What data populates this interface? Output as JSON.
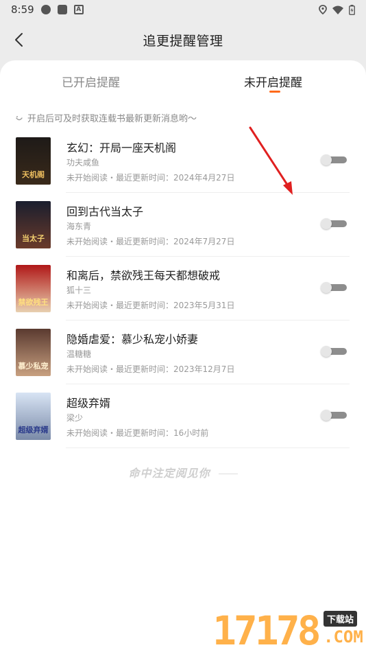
{
  "status_bar": {
    "time": "8:59",
    "icons": [
      "settings-icon",
      "square-app-icon",
      "a-app-icon",
      "location-icon",
      "wifi-icon",
      "battery-icon"
    ]
  },
  "header": {
    "title": "追更提醒管理",
    "back_icon": "chevron-left-icon"
  },
  "tabs": [
    {
      "label": "已开启提醒",
      "active": false
    },
    {
      "label": "未开启提醒",
      "active": true
    }
  ],
  "tip": "开启后可及时获取连载书最新更新消息哟～",
  "books": [
    {
      "title": "玄幻：开局一座天机阁",
      "author": "功夫咸鱼",
      "meta": "未开始阅读・最近更新时间：2024年4月27日",
      "cover_text": "天机阁",
      "cover_colors": [
        "#1e1a18",
        "#3a2a1a"
      ],
      "cover_text_color": "#f0c060",
      "toggle_on": false
    },
    {
      "title": "回到古代当太子",
      "author": "海东青",
      "meta": "未开始阅读・最近更新时间：2024年7月27日",
      "cover_text": "当太子",
      "cover_colors": [
        "#1a1e2e",
        "#6a3a2a"
      ],
      "cover_text_color": "#f2d070",
      "toggle_on": false
    },
    {
      "title": "和离后，禁欲残王每天都想破戒",
      "author": "狐十三",
      "meta": "未开始阅读・最近更新时间：2023年5月31日",
      "cover_text": "禁欲残王",
      "cover_colors": [
        "#b01818",
        "#e8d0b0"
      ],
      "cover_text_color": "#ffe080",
      "toggle_on": false
    },
    {
      "title": "隐婚虐爱：慕少私宠小娇妻",
      "author": "温糖糖",
      "meta": "未开始阅读・最近更新时间：2023年12月7日",
      "cover_text": "慕少私宠",
      "cover_colors": [
        "#5a3a30",
        "#c8a080"
      ],
      "cover_text_color": "#fff0d0",
      "toggle_on": false
    },
    {
      "title": "超级弃婿",
      "author": "梁少",
      "meta": "未开始阅读・最近更新时间：16小时前",
      "cover_text": "超级弃婿",
      "cover_colors": [
        "#d8e4f4",
        "#7a8aa8"
      ],
      "cover_text_color": "#2a3a8a",
      "toggle_on": false
    }
  ],
  "footer_slogan": "命中注定阅见你",
  "annotation": {
    "arrow_color": "#e02020"
  },
  "watermark": {
    "digits": "17178",
    "badge": "下载站",
    "domain": ".COM"
  },
  "colors": {
    "accent": "#ff6a1a",
    "background": "#ececec"
  }
}
